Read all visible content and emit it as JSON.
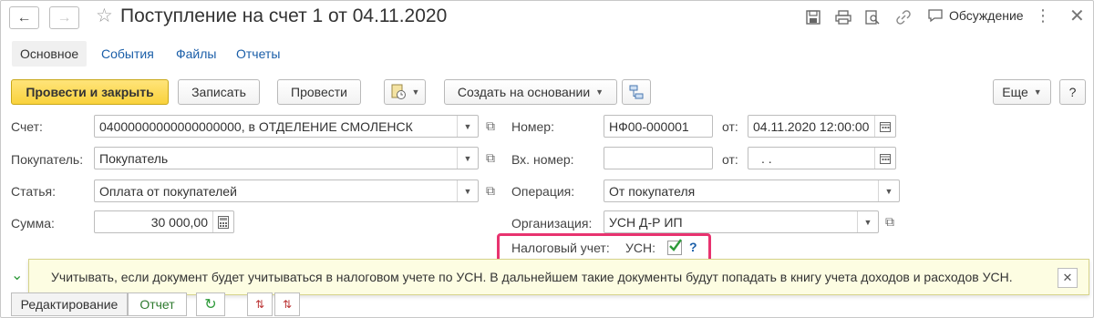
{
  "window": {
    "title": "Поступление на счет 1 от 04.11.2020",
    "discussion_label": "Обсуждение"
  },
  "tabs": [
    {
      "label": "Основное",
      "active": true
    },
    {
      "label": "События"
    },
    {
      "label": "Файлы"
    },
    {
      "label": "Отчеты"
    }
  ],
  "toolbar": {
    "post_close": "Провести и закрыть",
    "save": "Записать",
    "post": "Провести",
    "create_based": "Создать на основании",
    "more": "Еще",
    "help": "?"
  },
  "form": {
    "account_label": "Счет:",
    "account_value": "04000000000000000000, в ОТДЕЛЕНИЕ СМОЛЕНСК",
    "buyer_label": "Покупатель:",
    "buyer_value": "Покупатель",
    "article_label": "Статья:",
    "article_value": "Оплата от покупателей",
    "sum_label": "Сумма:",
    "sum_value": "30 000,00",
    "number_label": "Номер:",
    "number_value": "НФ00-000001",
    "from_label": "от:",
    "date_value": "04.11.2020 12:00:00",
    "in_number_label": "Вх. номер:",
    "in_number_value": "",
    "from_label_2": "от:",
    "in_date_value": " .  .",
    "operation_label": "Операция:",
    "operation_value": "От покупателя",
    "org_label": "Организация:",
    "org_value": "УСН Д-Р ИП",
    "tax_label": "Налоговый учет:",
    "usn_label": "УСН:",
    "usn_checked": true,
    "help_mark": "?"
  },
  "tooltip": {
    "text": "Учитывать, если документ будет учитываться в налоговом учете по УСН. В дальнейшем такие документы будут попадать в книгу учета доходов и расходов УСН."
  },
  "bottom": {
    "edit_label": "Редактирование",
    "report_label": "Отчет"
  },
  "colors": {
    "primary_button": "#f9d23c",
    "link": "#1a5ea8",
    "highlight": "#e8336f",
    "tooltip_bg": "#fdfde2",
    "checkbox_green": "#2e9a3a"
  }
}
